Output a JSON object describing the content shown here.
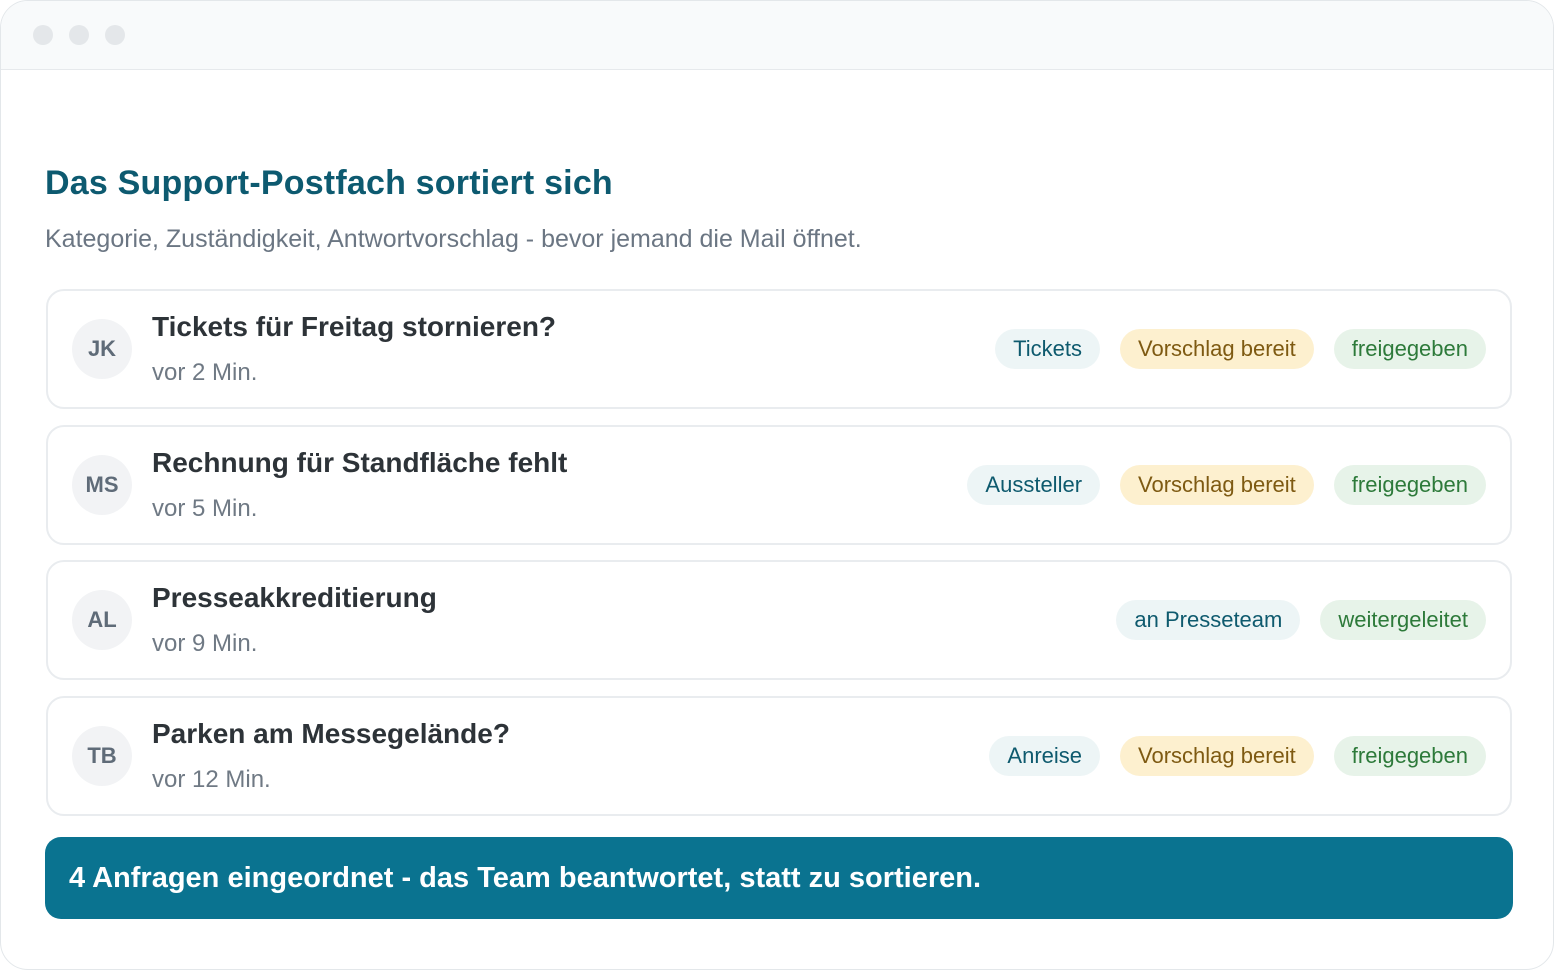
{
  "window": {
    "controls": [
      "close-dot",
      "minimize-dot",
      "maximize-dot"
    ]
  },
  "header": {
    "title": "Das Support-Postfach sortiert sich",
    "subtitle": "Kategorie, Zuständigkeit, Antwortvorschlag - bevor jemand die Mail öffnet."
  },
  "tickets": [
    {
      "initials": "JK",
      "subject": "Tickets für Freitag stornieren?",
      "time": "vor 2 Min.",
      "category": "Tickets",
      "suggestion": "Vorschlag bereit",
      "status": "freigegeben"
    },
    {
      "initials": "MS",
      "subject": "Rechnung für Standfläche fehlt",
      "time": "vor 5 Min.",
      "category": "Aussteller",
      "suggestion": "Vorschlag bereit",
      "status": "freigegeben"
    },
    {
      "initials": "AL",
      "subject": "Presseakkreditierung",
      "time": "vor 9 Min.",
      "category": "an Presseteam",
      "status": "weitergeleitet"
    },
    {
      "initials": "TB",
      "subject": "Parken am Messegelände?",
      "time": "vor 12 Min.",
      "category": "Anreise",
      "suggestion": "Vorschlag bereit",
      "status": "freigegeben"
    }
  ],
  "footer": {
    "summary": "4 Anfragen eingeordnet - das Team beantwortet, statt zu sortieren."
  },
  "colors": {
    "accent": "#0a7390",
    "title": "#0d5a70",
    "category_bg": "#edf5f6",
    "suggestion_bg": "#fdf0cf",
    "status_bg": "#e7f3e9"
  }
}
